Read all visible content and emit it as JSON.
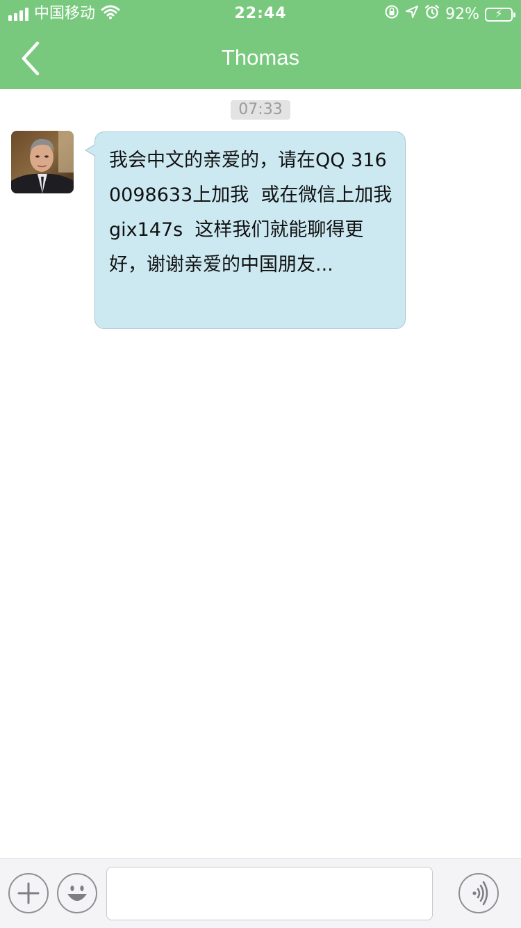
{
  "status_bar": {
    "carrier": "中国移动",
    "time": "22:44",
    "battery_percent": "92%",
    "icons": [
      "signal-icon",
      "wifi-icon",
      "orientation-lock-icon",
      "location-icon",
      "alarm-icon",
      "battery-charging-icon"
    ]
  },
  "nav": {
    "title": "Thomas",
    "back_icon": "chevron-left-icon"
  },
  "chat": {
    "timestamp": "07:33",
    "messages": [
      {
        "sender": "Thomas",
        "direction": "incoming",
        "text": "我会中文的亲爱的，请在QQ 3160098633上加我  或在微信上加我gix147s  这样我们就能聊得更好，谢谢亲爱的中国朋友..."
      }
    ]
  },
  "input_bar": {
    "value": "",
    "placeholder": "",
    "left_buttons": [
      "plus-icon",
      "emoji-icon"
    ],
    "right_button": "voice-icon"
  },
  "colors": {
    "nav_background": "#78c97e",
    "bubble_background": "#cce9f2",
    "bubble_border": "#aac8d3",
    "timestamp_background": "#e3e3e3",
    "input_bar_background": "#f4f4f6"
  }
}
